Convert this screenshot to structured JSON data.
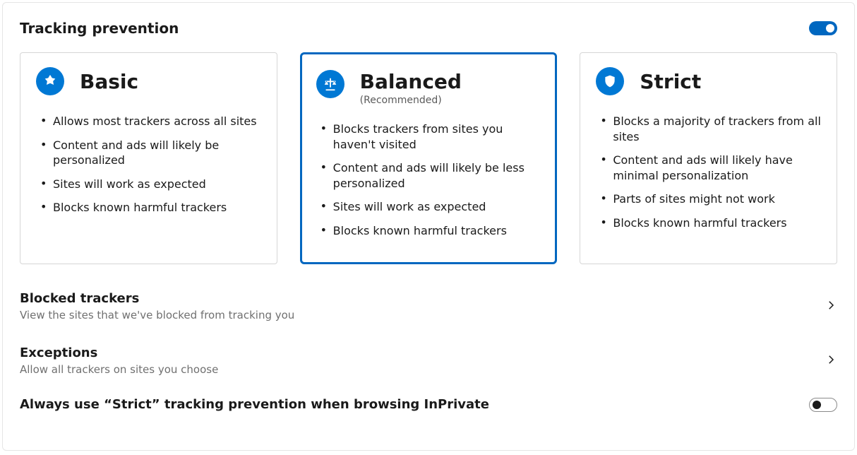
{
  "header": {
    "title": "Tracking prevention",
    "main_toggle_on": true
  },
  "cards": {
    "basic": {
      "title": "Basic",
      "items": [
        "Allows most trackers across all sites",
        "Content and ads will likely be personalized",
        "Sites will work as expected",
        "Blocks known harmful trackers"
      ]
    },
    "balanced": {
      "title": "Balanced",
      "subtitle": "(Recommended)",
      "selected": true,
      "items": [
        "Blocks trackers from sites you haven't visited",
        "Content and ads will likely be less personalized",
        "Sites will work as expected",
        "Blocks known harmful trackers"
      ]
    },
    "strict": {
      "title": "Strict",
      "items": [
        "Blocks a majority of trackers from all sites",
        "Content and ads will likely have minimal personalization",
        "Parts of sites might not work",
        "Blocks known harmful trackers"
      ]
    }
  },
  "links": {
    "blocked": {
      "title": "Blocked trackers",
      "desc": "View the sites that we've blocked from tracking you"
    },
    "exceptions": {
      "title": "Exceptions",
      "desc": "Allow all trackers on sites you choose"
    }
  },
  "strict_inprivate": {
    "label": "Always use “Strict” tracking prevention when browsing InPrivate",
    "toggle_on": false
  },
  "colors": {
    "accent": "#0067c0",
    "icon_bg": "#0078d4"
  }
}
